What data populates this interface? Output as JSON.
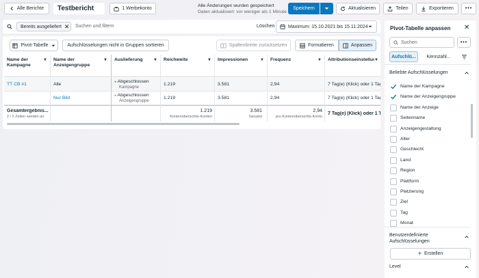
{
  "topbar": {
    "back_label": "Alle Berichte",
    "report_title": "Testbericht",
    "ad_account_label": "1 Werbekonto",
    "status_line1": "Alle Änderungen wurden gespeichert",
    "status_line2": "Daten aktualisiert: vor weniger als 1 Minute",
    "save_label": "Speichern",
    "refresh_label": "Aktualisieren",
    "share_label": "Teilen",
    "export_label": "Exportieren"
  },
  "filter": {
    "chip_label": "Bereits ausgeliefert",
    "search_placeholder": "Suchen und filtern",
    "clear_label": "Löschen",
    "date_label": "Maximum: 15.10.2021 bis 15.11.2024"
  },
  "toolbar": {
    "pivot_label": "Pivot-Tabelle",
    "sort_label": "Aufschlüsselungen nicht in Gruppen sortieren",
    "reset_width_label": "Spaltenbreite zurücksetzen",
    "format_label": "Formatieren",
    "customize_label": "Anpassen"
  },
  "table": {
    "columns": [
      "Name der Kampagne",
      "Name der Anzeigengruppe",
      "Auslieferung",
      "Reichweite",
      "Impressionen",
      "Frequenz",
      "Attributionseinstellung"
    ],
    "rows": [
      {
        "campaign": "TT CB #1",
        "adset": "Alle",
        "delivery_status": "Abgeschlossen",
        "delivery_sub": "Kampagne",
        "reach": "1.219",
        "impressions": "3.581",
        "frequency": "2,94",
        "attribution": "7 Tag(e) (Klick) oder 1 Tag..."
      },
      {
        "campaign": "",
        "adset": "Nur Bild",
        "delivery_status": "Abgeschlossen",
        "delivery_sub": "Anzeigengruppe",
        "reach": "1.219",
        "impressions": "3.581",
        "frequency": "2,94",
        "attribution": "7 Tag(e) (Klick) oder 1 Tag..."
      }
    ],
    "total": {
      "label": "Gesamtergebnis...",
      "sub": "2 / 2 Zeilen werden an",
      "reach": "1.219",
      "reach_sub": "Kontenübersichts-Konten",
      "impressions": "3.581",
      "impressions_sub": "Gesamt",
      "frequency": "2,94",
      "frequency_sub": "pro Kontenübersichts-Konto",
      "attribution": "7 Tag(e) (Klick) oder 1 T..."
    }
  },
  "sidebar": {
    "title": "Pivot-Tabelle anpassen",
    "search_placeholder": "Suchen",
    "tab_breakdowns": "Aufschlü...",
    "tab_metrics": "Kennzahl...",
    "section_popular": "Beliebte Aufschlüsselungen",
    "items": [
      {
        "label": "Name der Kampagne",
        "checked": true
      },
      {
        "label": "Name der Anzeigengruppe",
        "checked": true
      },
      {
        "label": "Name der Anzeige",
        "checked": false
      },
      {
        "label": "Seitenname",
        "checked": false
      },
      {
        "label": "Anzeigengestaltung",
        "checked": false
      },
      {
        "label": "Alter",
        "checked": false
      },
      {
        "label": "Geschlecht",
        "checked": false
      },
      {
        "label": "Land",
        "checked": false
      },
      {
        "label": "Region",
        "checked": false
      },
      {
        "label": "Plattform",
        "checked": false
      },
      {
        "label": "Platzierung",
        "checked": false
      },
      {
        "label": "Ziel",
        "checked": false
      },
      {
        "label": "Tag",
        "checked": false
      },
      {
        "label": "Monat",
        "checked": false
      }
    ],
    "section_custom_line1": "Benutzerdefinierte",
    "section_custom_line2": "Aufschlüsselungen",
    "create_label": "Erstellen",
    "section_level": "Level"
  },
  "colors": {
    "accent": "#0a78be",
    "check": "#0a78be",
    "border": "#c9ccd1"
  }
}
